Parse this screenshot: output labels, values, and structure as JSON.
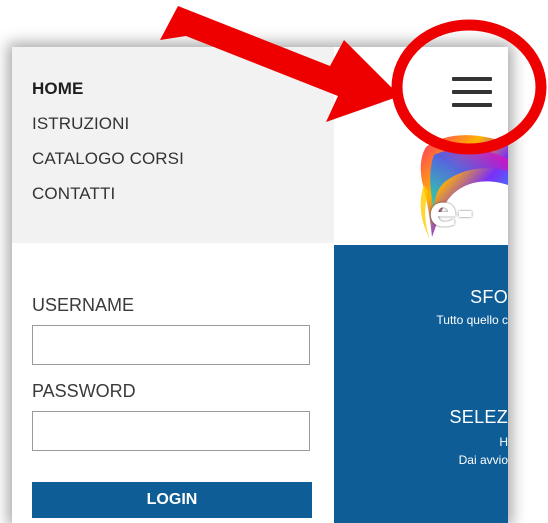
{
  "nav": {
    "items": [
      {
        "label": "HOME",
        "active": true
      },
      {
        "label": "ISTRUZIONI",
        "active": false
      },
      {
        "label": "CATALOGO CORSI",
        "active": false
      },
      {
        "label": "CONTATTI",
        "active": false
      }
    ],
    "menu_icon": "hamburger-menu-icon"
  },
  "logo": {
    "text": "e-"
  },
  "banner": {
    "title_1": "SFO",
    "subtitle_1": "Tutto quello c",
    "title_2": "SELEZ",
    "subtitle_2a": "H",
    "subtitle_2b": "Dai avvio"
  },
  "login": {
    "username_label": "USERNAME",
    "username_value": "",
    "password_label": "PASSWORD",
    "password_value": "",
    "button_label": "LOGIN"
  },
  "annotation": {
    "arrow_color": "#ee0000",
    "circle_color": "#ee0000"
  },
  "colors": {
    "brand_blue": "#0f5d96",
    "menu_bg": "#f2f2f2",
    "text_dark": "#333333"
  }
}
